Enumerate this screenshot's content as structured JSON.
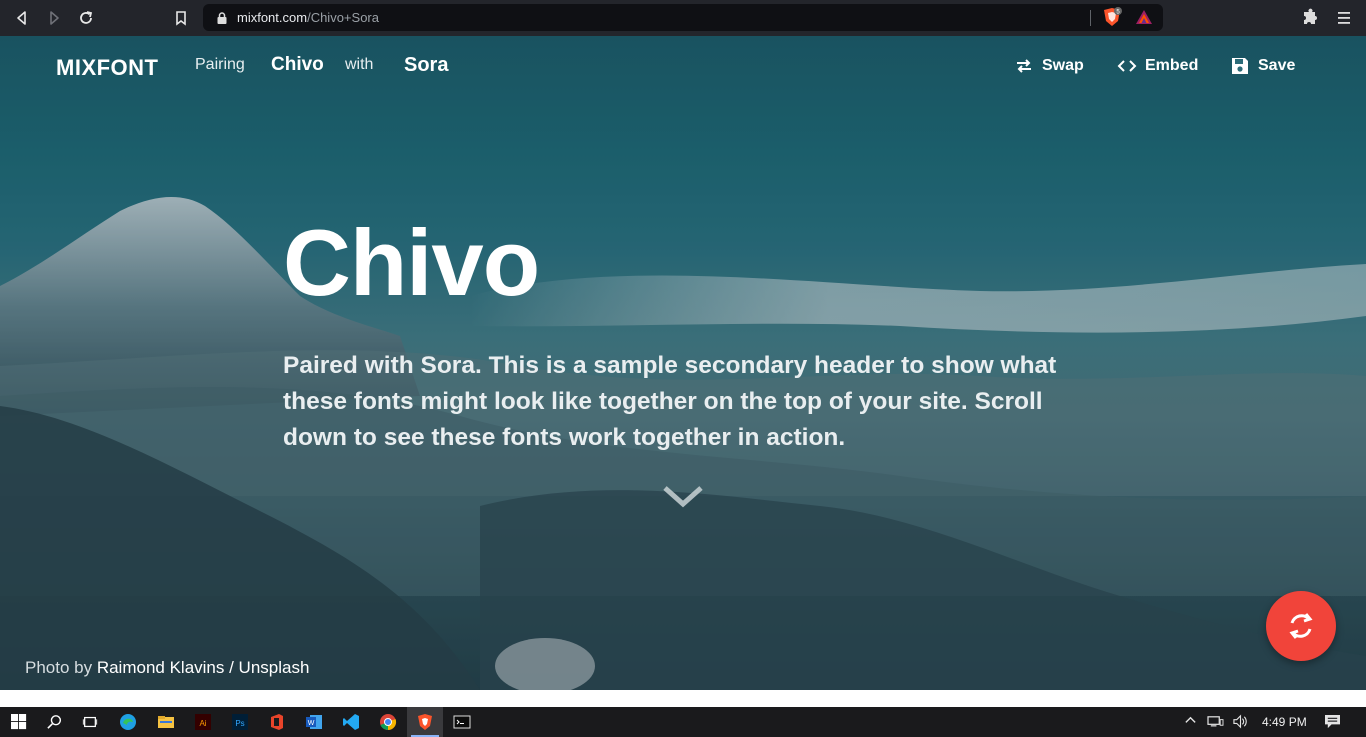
{
  "browser": {
    "url_host": "mixfont.com",
    "url_path": "/Chivo+Sora",
    "shield_count": "5"
  },
  "header": {
    "logo": "MIXFONT",
    "pairing_label": "Pairing",
    "font_primary": "Chivo",
    "with_label": "with",
    "font_secondary": "Sora",
    "swap_label": "Swap",
    "embed_label": "Embed",
    "save_label": "Save"
  },
  "hero": {
    "headline": "Chivo",
    "subheader": "Paired with Sora. This is a sample secondary header to show what these fonts might look like together on the top of your site. Scroll down to see these fonts work together in action.",
    "credit_prefix": "Photo by ",
    "credit_name": "Raimond Klavins / Unsplash"
  },
  "taskbar": {
    "clock": "4:49 PM"
  },
  "colors": {
    "fab": "#f1443a",
    "browser_bar": "#23252b",
    "hero_teal": "#1f6d7a"
  }
}
